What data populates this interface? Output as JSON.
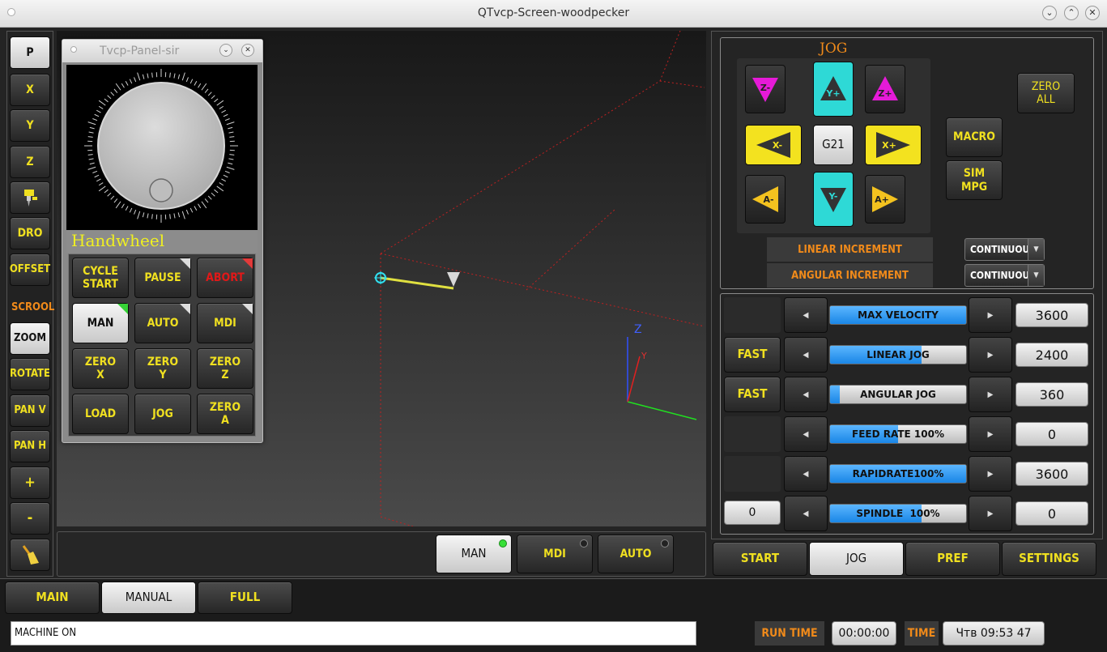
{
  "window": {
    "title": "QTvcp-Screen-woodpecker"
  },
  "left_toolbar": {
    "p": "P",
    "x": "X",
    "y": "Y",
    "z": "Z",
    "dro": "DRO",
    "offset": "OFFSET",
    "scroll": "SCROOL",
    "zoom": "ZOOM",
    "rotate": "ROTATE",
    "pan_v": "PAN V",
    "pan_h": "PAN H",
    "plus": "+",
    "minus": "-"
  },
  "panel": {
    "title": "Tvcp-Panel-sir",
    "handwheel_label": "Handwheel",
    "buttons": {
      "cycle_start": "CYCLE\nSTART",
      "pause": "PAUSE",
      "abort": "ABORT",
      "man": "MAN",
      "auto": "AUTO",
      "mdi": "MDI",
      "zero_x": "ZERO\nX",
      "zero_y": "ZERO\nY",
      "zero_z": "ZERO\nZ",
      "load": "LOAD",
      "jog": "JOG",
      "zero_a": "ZERO\nA"
    }
  },
  "preview": {
    "axis_z": "Z",
    "axis_y": "Y"
  },
  "mode_bar": {
    "man": "MAN",
    "mdi": "MDI",
    "auto": "AUTO"
  },
  "jog_panel": {
    "title": "JOG",
    "buttons": {
      "z_minus": "Z-",
      "y_plus": "Y+",
      "z_plus": "Z+",
      "x_minus": "X-",
      "g21": "G21",
      "x_plus": "X+",
      "a_minus": "A-",
      "y_minus": "Y-",
      "a_plus": "A+"
    },
    "zero_all": "ZERO\nALL",
    "macro": "MACRO",
    "sim_mpg": "SIM\nMPG",
    "linear_increment": "LINEAR INCREMENT",
    "angular_increment": "ANGULAR INCREMENT",
    "linear_increment_value": "CONTINUOUS",
    "angular_increment_value": "CONTINUOUS"
  },
  "rates": [
    {
      "label": "MAX VELOCITY",
      "value": "3600",
      "fill_percent": 100,
      "side": ""
    },
    {
      "label": "LINEAR JOG",
      "value": "2400",
      "fill_percent": 67,
      "side": "FAST"
    },
    {
      "label": "ANGULAR JOG",
      "value": "360",
      "fill_percent": 7,
      "side": "FAST"
    },
    {
      "label": "FEED RATE 100%",
      "value": "0",
      "fill_percent": 50,
      "side": ""
    },
    {
      "label": "RAPIDRATE100%",
      "value": "3600",
      "fill_percent": 100,
      "side": ""
    },
    {
      "label": "SPINDLE  100%",
      "value": "0",
      "fill_percent": 67,
      "side": "0"
    }
  ],
  "right_tabs": {
    "start": "START",
    "jog": "JOG",
    "pref": "PREF",
    "settings": "SETTINGS"
  },
  "bottom_tabs": {
    "main": "MAIN",
    "manual": "MANUAL",
    "full": "FULL"
  },
  "status": {
    "message": "MACHINE ON",
    "run_time_label": "RUN TIME",
    "run_time": "00:00:00",
    "time_label": "TIME",
    "time": "Чтв 09:53 47"
  },
  "colors": {
    "accent_yellow": "#f0e020",
    "accent_orange": "#f08a1a",
    "jog_yellow": "#f3e21f",
    "jog_cyan": "#2ed9d6",
    "jog_magenta": "#e61ad8"
  }
}
